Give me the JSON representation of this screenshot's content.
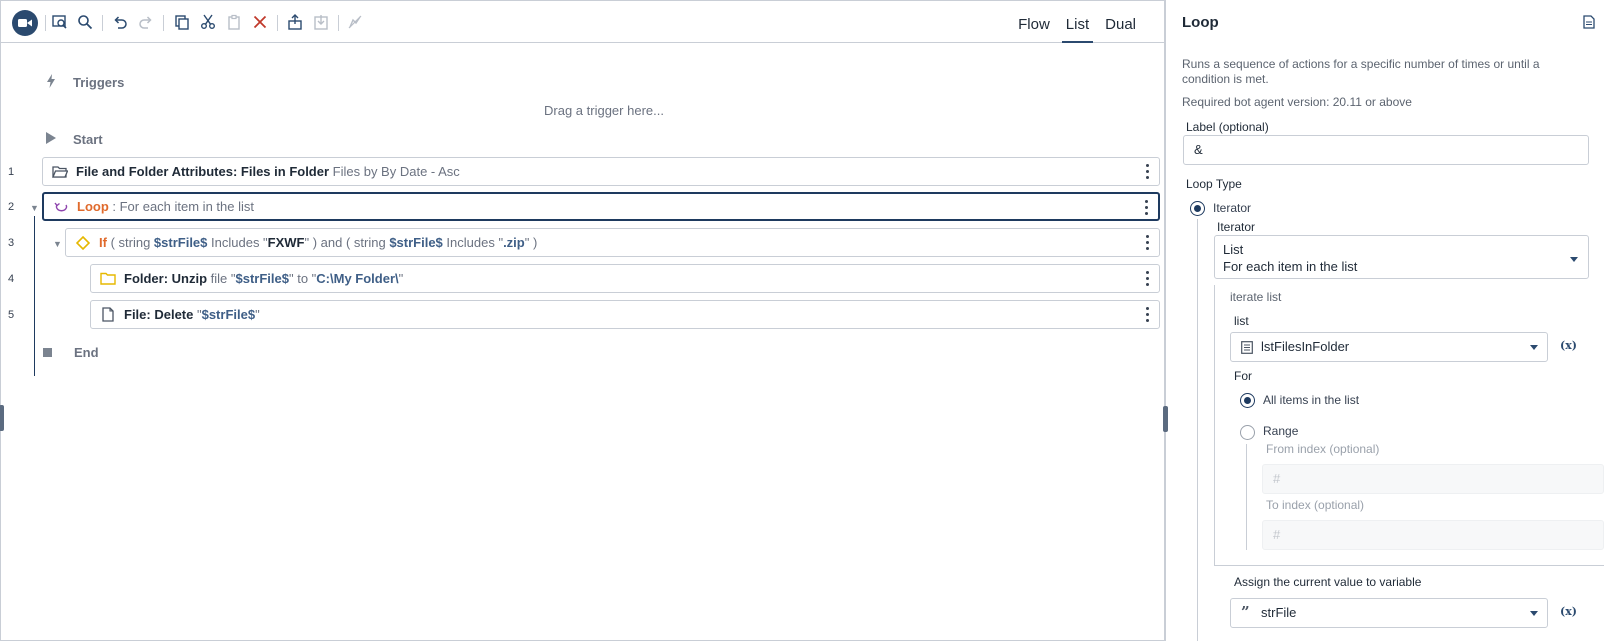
{
  "toolbar": {
    "icons": [
      "record-icon",
      "find-icon",
      "search-icon",
      "undo-icon",
      "redo-icon",
      "copy-icon",
      "cut-icon",
      "paste-icon",
      "delete-icon",
      "export-icon",
      "import-icon",
      "disable-icon"
    ],
    "view_tabs": [
      {
        "label": "Flow",
        "active": false
      },
      {
        "label": "List",
        "active": true
      },
      {
        "label": "Dual",
        "active": false
      }
    ]
  },
  "canvas": {
    "triggers_label": "Triggers",
    "drag_hint": "Drag a trigger here...",
    "start_label": "Start",
    "end_label": "End",
    "actions": [
      {
        "line": "1",
        "parts": [
          {
            "t": "File and Folder Attributes: Files in Folder",
            "s": "bold"
          },
          {
            "t": " Files by By Date - Asc",
            "s": "muted"
          }
        ]
      },
      {
        "line": "2",
        "parts": [
          {
            "t": "Loop",
            "s": "orange"
          },
          {
            "t": " : For each item in the list",
            "s": "muted"
          }
        ]
      },
      {
        "line": "3",
        "parts": [
          {
            "t": "If",
            "s": "orange"
          },
          {
            "t": " ( string ",
            "s": "muted"
          },
          {
            "t": "$strFile$",
            "s": "var"
          },
          {
            "t": " Includes \"",
            "s": "muted"
          },
          {
            "t": "FXWF",
            "s": "bold"
          },
          {
            "t": "\" ) and ( string ",
            "s": "muted"
          },
          {
            "t": "$strFile$",
            "s": "var"
          },
          {
            "t": " Includes \"",
            "s": "muted"
          },
          {
            "t": ".zip",
            "s": "var"
          },
          {
            "t": "\" )",
            "s": "muted"
          }
        ]
      },
      {
        "line": "4",
        "parts": [
          {
            "t": "Folder: Unzip",
            "s": "bold"
          },
          {
            "t": " file \"",
            "s": "muted"
          },
          {
            "t": "$strFile$",
            "s": "var"
          },
          {
            "t": "\" to \"",
            "s": "muted"
          },
          {
            "t": "C:\\My Folder\\",
            "s": "var"
          },
          {
            "t": "\"",
            "s": "muted"
          }
        ]
      },
      {
        "line": "5",
        "parts": [
          {
            "t": "File: Delete",
            "s": "bold"
          },
          {
            "t": " \"",
            "s": "muted"
          },
          {
            "t": "$strFile$",
            "s": "var"
          },
          {
            "t": "\"",
            "s": "muted"
          }
        ]
      }
    ]
  },
  "panel": {
    "title": "Loop",
    "description": "Runs a sequence of actions for a specific number of times or until a condition is met.",
    "required_version": "Required bot agent version: 20.11 or above",
    "label_field": {
      "label": "Label (optional)",
      "value": "&"
    },
    "loop_type": {
      "label": "Loop Type",
      "selected": "Iterator",
      "iterator_label": "Iterator",
      "iterator_select": {
        "title": "List",
        "subtitle": "For each item in the list"
      }
    },
    "iterate_list": {
      "section_label": "iterate list",
      "list_label": "list",
      "list_value": "lstFilesInFolder",
      "for_label": "For",
      "options": [
        "All items in the list",
        "Range"
      ],
      "selected_option": "All items in the list",
      "from_label": "From index (optional)",
      "from_placeholder": "#",
      "to_label": "To index (optional)",
      "to_placeholder": "#"
    },
    "assign": {
      "label": "Assign the current value to variable",
      "value": "strFile"
    },
    "fx_glyph": "(x)"
  }
}
